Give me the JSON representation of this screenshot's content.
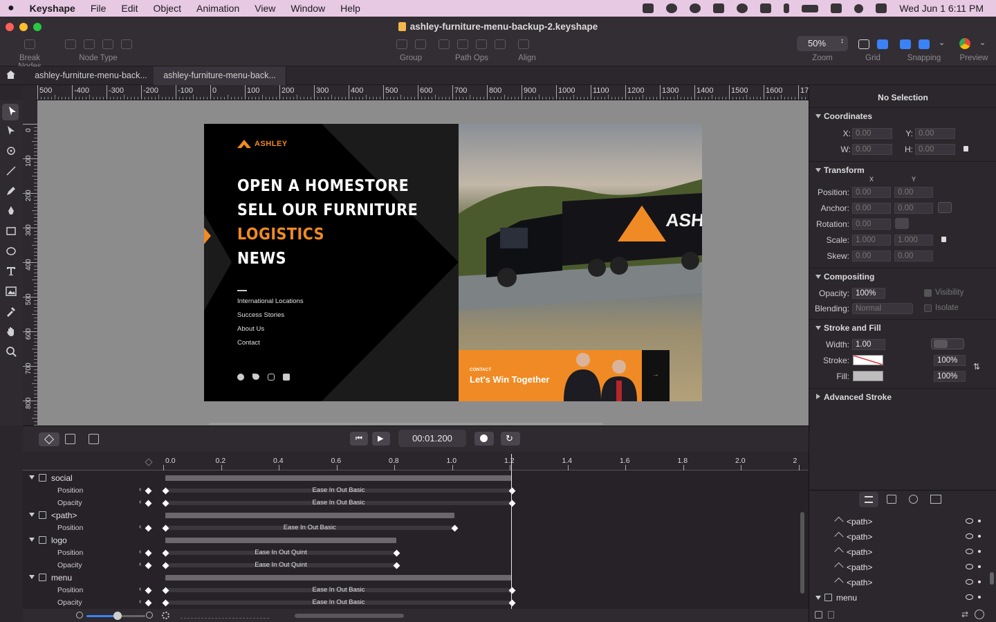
{
  "menubar": {
    "app": "Keyshape",
    "items": [
      "File",
      "Edit",
      "Object",
      "Animation",
      "View",
      "Window",
      "Help"
    ],
    "clock": "Wed Jun 1  6:11 PM"
  },
  "window": {
    "title": "ashley-furniture-menu-backup-2.keyshape"
  },
  "toolbar": {
    "break_nodes": "Break Nodes",
    "node_type": "Node Type",
    "group": "Group",
    "path_ops": "Path Ops",
    "align": "Align",
    "zoom_value": "50%",
    "zoom": "Zoom",
    "grid": "Grid",
    "snapping": "Snapping",
    "preview": "Preview"
  },
  "tabs": [
    {
      "label": "ashley-furniture-menu-back..."
    },
    {
      "label": "ashley-furniture-menu-back..."
    }
  ],
  "ruler": {
    "h": [
      "500",
      "-400",
      "-300",
      "-200",
      "-100",
      "0",
      "100",
      "200",
      "300",
      "400",
      "500",
      "600",
      "700",
      "800",
      "900",
      "1000",
      "1100",
      "1200",
      "1300",
      "1400",
      "1500",
      "1600",
      "170"
    ],
    "v": [
      "0",
      "100",
      "200",
      "300",
      "400",
      "500",
      "600",
      "700",
      "800"
    ]
  },
  "artboard": {
    "brand": "ASHLEY",
    "menu": [
      "OPEN A HOMESTORE",
      "SELL OUR FURNITURE",
      "LOGISTICS",
      "NEWS"
    ],
    "links": [
      "International Locations",
      "Success Stories",
      "About Us",
      "Contact"
    ],
    "truck_brand": "ASHL",
    "contact_kicker": "CONTACT",
    "contact_title": "Let's Win Together",
    "accent": "#f08a24"
  },
  "timeline": {
    "time": "00:01.200",
    "ticks": [
      "0.0",
      "0.2",
      "0.4",
      "0.6",
      "0.8",
      "1.0",
      "1.2",
      "1.4",
      "1.6",
      "1.8",
      "2.0",
      "2"
    ],
    "rows": [
      {
        "type": "group",
        "name": "social"
      },
      {
        "type": "prop",
        "name": "Position",
        "ease": "Ease In Out Basic"
      },
      {
        "type": "prop",
        "name": "Opacity",
        "ease": "Ease In Out Basic"
      },
      {
        "type": "group",
        "name": "<path>"
      },
      {
        "type": "prop",
        "name": "Position",
        "ease": "Ease In Out Basic"
      },
      {
        "type": "group",
        "name": "logo"
      },
      {
        "type": "prop",
        "name": "Position",
        "ease": "Ease In Out Quint"
      },
      {
        "type": "prop",
        "name": "Opacity",
        "ease": "Ease In Out Quint"
      },
      {
        "type": "group",
        "name": "menu"
      },
      {
        "type": "prop",
        "name": "Position",
        "ease": "Ease In Out Basic"
      },
      {
        "type": "prop",
        "name": "Opacity",
        "ease": "Ease In Out Basic"
      }
    ]
  },
  "inspector": {
    "title": "No Selection",
    "coordinates": {
      "title": "Coordinates",
      "x_label": "X:",
      "x": "0.00",
      "y_label": "Y:",
      "y": "0.00",
      "w_label": "W:",
      "w": "0.00",
      "h_label": "H:",
      "h": "0.00"
    },
    "transform": {
      "title": "Transform",
      "col_x": "X",
      "col_y": "Y",
      "position": "Position:",
      "anchor": "Anchor:",
      "rotation": "Rotation:",
      "scale": "Scale:",
      "skew": "Skew:",
      "zero": "0.00",
      "one": "1.000"
    },
    "compositing": {
      "title": "Compositing",
      "opacity_label": "Opacity:",
      "opacity": "100%",
      "visibility": "Visibility",
      "blending_label": "Blending:",
      "blending": "Normal",
      "isolate": "Isolate"
    },
    "stroke_fill": {
      "title": "Stroke and Fill",
      "width_label": "Width:",
      "width": "1.00",
      "stroke_label": "Stroke:",
      "stroke_pct": "100%",
      "fill_label": "Fill:",
      "fill_pct": "100%"
    },
    "advanced_stroke": "Advanced Stroke"
  },
  "layers": {
    "items": [
      "<path>",
      "<path>",
      "<path>",
      "<path>",
      "<path>",
      "menu"
    ]
  }
}
